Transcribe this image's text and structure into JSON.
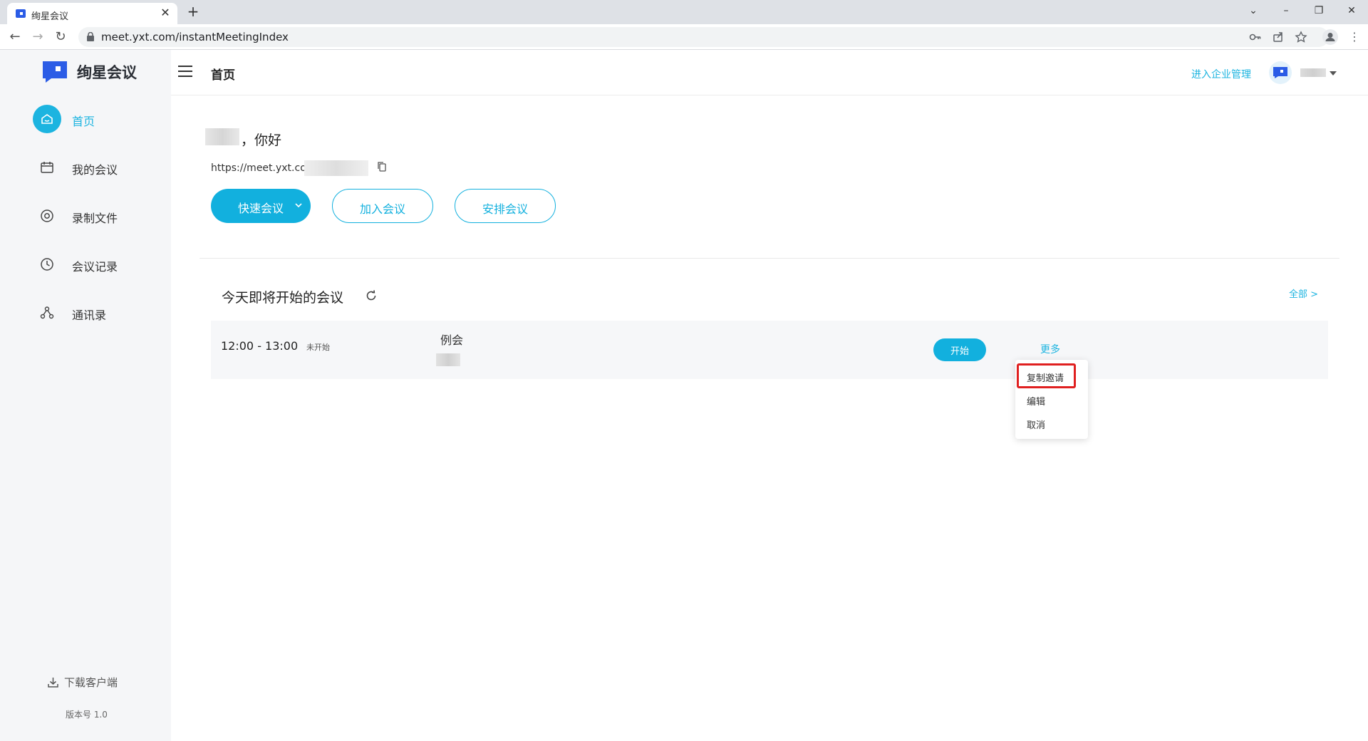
{
  "browser": {
    "tab_title": "绚星会议",
    "tab_close": "✕",
    "new_tab": "+",
    "url": "meet.yxt.com/instantMeetingIndex"
  },
  "sidebar": {
    "logo_text": "绚星会议",
    "items": [
      {
        "label": "首页",
        "icon": "home-icon",
        "active": true
      },
      {
        "label": "我的会议",
        "icon": "calendar-icon",
        "active": false
      },
      {
        "label": "录制文件",
        "icon": "record-icon",
        "active": false
      },
      {
        "label": "会议记录",
        "icon": "clock-icon",
        "active": false
      },
      {
        "label": "通讯录",
        "icon": "contacts-icon",
        "active": false
      }
    ],
    "download_label": "下载客户端",
    "version": "版本号 1.0"
  },
  "header": {
    "title": "首页",
    "enterprise_link": "进入企业管理"
  },
  "welcome": {
    "greeting": "，你好",
    "meeting_link_prefix": "https://meet.yxt.com/"
  },
  "actions": {
    "quick_meeting": "快速会议",
    "join_meeting": "加入会议",
    "schedule_meeting": "安排会议"
  },
  "today": {
    "title": "今天即将开始的会议",
    "all_link": "全部 >",
    "meetings": [
      {
        "time": "12:00 - 13:00",
        "status": "未开始",
        "name": "例会",
        "start_label": "开始",
        "more_label": "更多"
      }
    ]
  },
  "more_menu": {
    "items": [
      "复制邀请",
      "编辑",
      "取消"
    ],
    "highlighted": "复制邀请"
  },
  "colors": {
    "accent": "#12b0de",
    "sidebar_bg": "#f5f6f8",
    "highlight_border": "#e02020"
  }
}
